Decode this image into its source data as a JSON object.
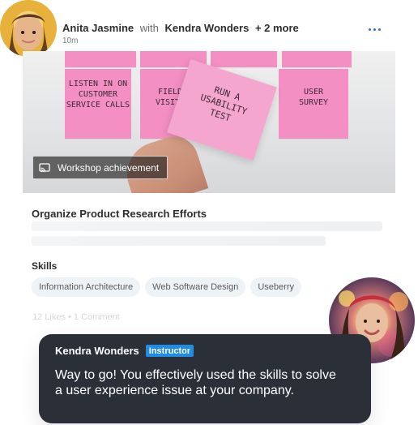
{
  "post": {
    "author": "Anita Jasmine",
    "with_text": "with",
    "coauthor": "Kendra Wonders",
    "plus_more": "+ 2 more",
    "time": "10m"
  },
  "image": {
    "badge_label": "Workshop achievement",
    "notes": {
      "note_1": [
        "LISTEN IN ON",
        "CUSTOMER",
        "SERVICE CALLS"
      ],
      "note_2": [
        "FIELD",
        "VISITS"
      ],
      "note_3": [
        "USER",
        "SURVEY"
      ],
      "held": [
        "RUN A",
        "USABILITY",
        "TEST"
      ]
    }
  },
  "course": {
    "title": "Organize Product Research Efforts"
  },
  "skills": {
    "label": "Skills",
    "items": [
      "Information Architecture",
      "Web Software Design",
      "Useberry"
    ]
  },
  "engagement": {
    "text": "12 Likes • 1 Comment"
  },
  "comment": {
    "author": "Kendra Wonders",
    "badge": "Instructor",
    "text": "Way to go! You effectively used the skills to solve a user experience issue at your company."
  },
  "icons": {
    "more": "more-horizontal-icon",
    "badge": "cast-icon"
  },
  "colors": {
    "accent": "#1f8ce6",
    "comment_bg": "#2b3038",
    "pill_bg": "#eef3f8"
  }
}
